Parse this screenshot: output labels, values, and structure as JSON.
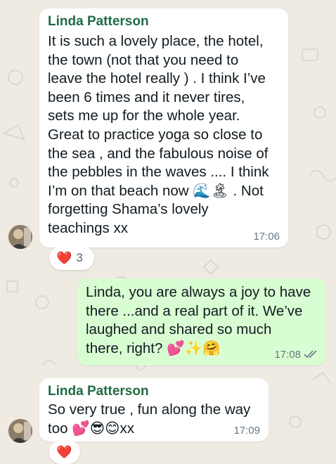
{
  "messages": [
    {
      "sender": "Linda Patterson",
      "text": "It is such a lovely place, the hotel,\nthe town (not that you need to\nleave the hotel really ) .  I think I’ve\nbeen 6 times and it never tires,\nsets me up for the whole year.\nGreat to practice yoga so close to\nthe sea , and the fabulous noise of\nthe pebbles in the waves .... I think\nI’m on that beach now 🌊🏝 . Not\nforgetting Shama’s lovely\nteachings xx",
      "time": "17:06",
      "reaction": {
        "emoji": "❤️",
        "count": "3"
      }
    },
    {
      "text": "Linda, you are always a joy to have\nthere ...and a real part of it. We’ve\nlaughed and shared so much\nthere, right? 💕✨🤗",
      "time": "17:08",
      "status": "read"
    },
    {
      "sender": "Linda Patterson",
      "text": "So very true , fun along the way\ntoo 💕😎😊xx",
      "time": "17:09",
      "reaction": {
        "emoji": "❤️"
      }
    }
  ],
  "colors": {
    "chat_background": "#efeae2",
    "incoming_bubble": "#ffffff",
    "outgoing_bubble": "#d9fdd3",
    "sender_name": "#1f6b46",
    "timestamp": "#667781",
    "read_ticks": "#667781"
  }
}
